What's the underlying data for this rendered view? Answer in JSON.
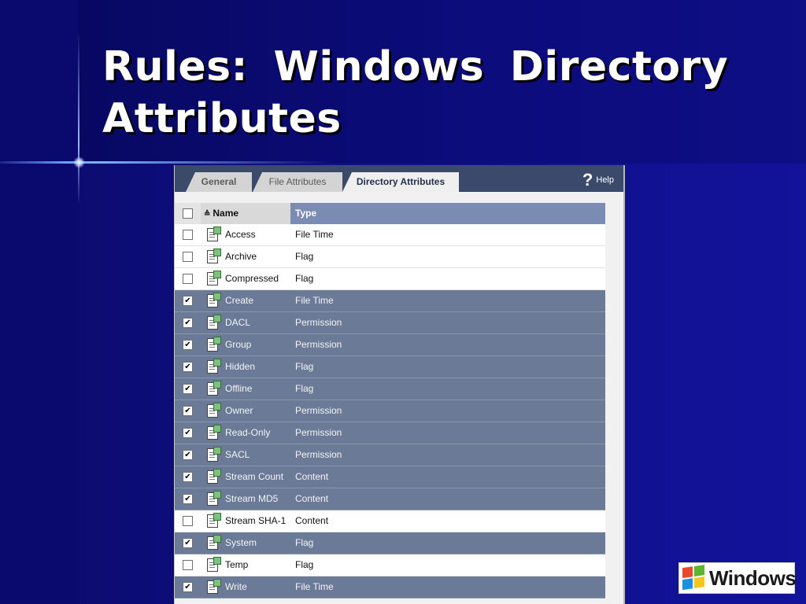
{
  "slide": {
    "title": "Rules: Windows Directory Attributes",
    "logo_text": "Windows"
  },
  "tabs": [
    {
      "label": "General",
      "active": false
    },
    {
      "label": "File Attributes",
      "active": false
    },
    {
      "label": "Directory Attributes",
      "active": true
    }
  ],
  "help": {
    "label": "Help",
    "icon": "help-question-icon"
  },
  "table": {
    "columns": [
      "Name",
      "Type"
    ],
    "sort_icon": "sort-ascending-icon",
    "row_icon": "attribute-file-icon",
    "rows": [
      {
        "name": "Access",
        "type": "File Time",
        "checked": false
      },
      {
        "name": "Archive",
        "type": "Flag",
        "checked": false
      },
      {
        "name": "Compressed",
        "type": "Flag",
        "checked": false
      },
      {
        "name": "Create",
        "type": "File Time",
        "checked": true
      },
      {
        "name": "DACL",
        "type": "Permission",
        "checked": true
      },
      {
        "name": "Group",
        "type": "Permission",
        "checked": true
      },
      {
        "name": "Hidden",
        "type": "Flag",
        "checked": true
      },
      {
        "name": "Offline",
        "type": "Flag",
        "checked": true
      },
      {
        "name": "Owner",
        "type": "Permission",
        "checked": true
      },
      {
        "name": "Read-Only",
        "type": "Permission",
        "checked": true
      },
      {
        "name": "SACL",
        "type": "Permission",
        "checked": true
      },
      {
        "name": "Stream Count",
        "type": "Content",
        "checked": true
      },
      {
        "name": "Stream MD5",
        "type": "Content",
        "checked": true
      },
      {
        "name": "Stream SHA-1",
        "type": "Content",
        "checked": false
      },
      {
        "name": "System",
        "type": "Flag",
        "checked": true
      },
      {
        "name": "Temp",
        "type": "Flag",
        "checked": false
      },
      {
        "name": "Write",
        "type": "File Time",
        "checked": true
      }
    ]
  },
  "colors": {
    "slide_background": "#0a0a7a",
    "header_row": "#7a8cb2",
    "selected_row": "#6b7a97",
    "tab_bar": "#3b4a6a"
  }
}
